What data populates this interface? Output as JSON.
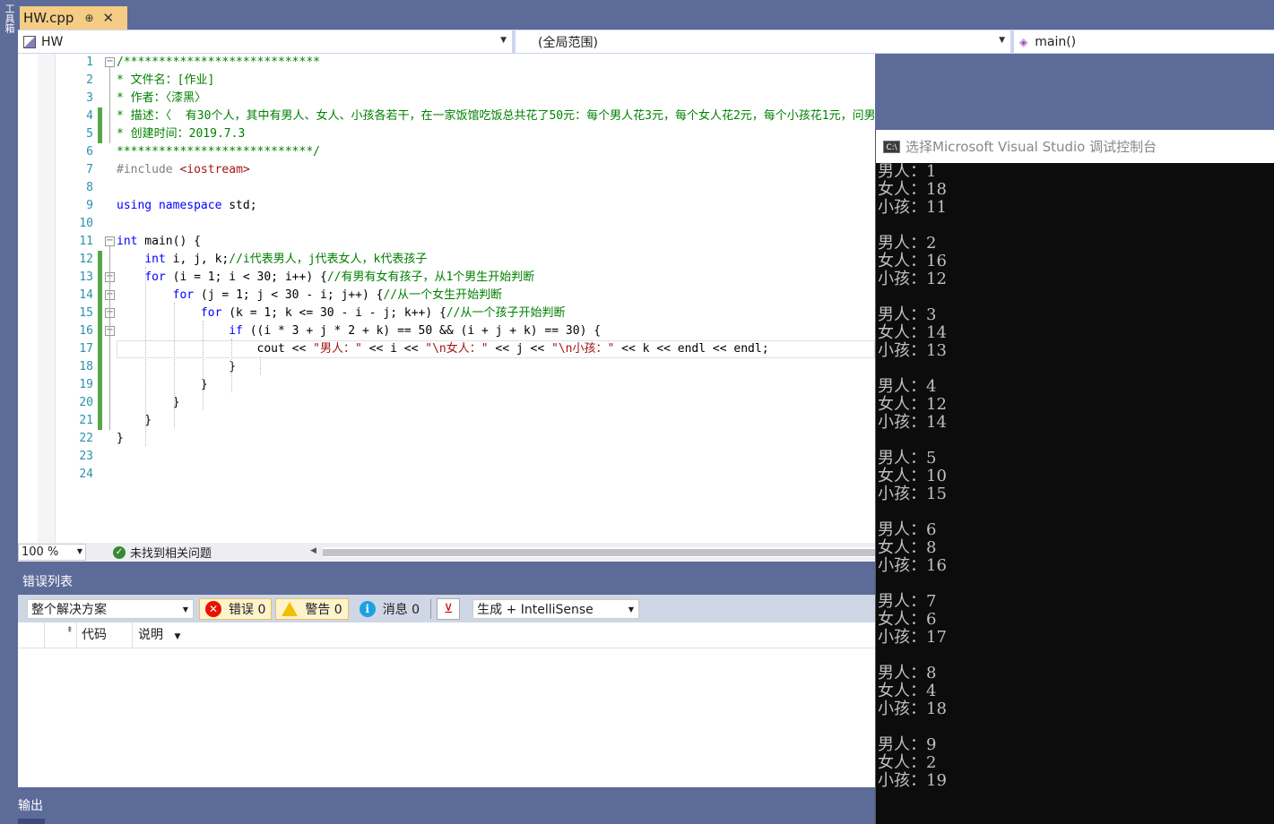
{
  "toolstrip": {
    "label": "工具箱"
  },
  "tab": {
    "title": "HW.cpp",
    "pin": "⊕",
    "close": "✕"
  },
  "nav": {
    "project": "HW",
    "scope": "(全局范围)",
    "member": "main()"
  },
  "code_lines": [
    {
      "n": "1",
      "html": "<span class='cm'>/****************************</span>"
    },
    {
      "n": "2",
      "html": "<span class='cm'>* 文件名：[作业]</span>"
    },
    {
      "n": "3",
      "html": "<span class='cm'>* 作者：〈漆黑〉</span>"
    },
    {
      "n": "4",
      "html": "<span class='cm'>* 描述：〈  有30个人，其中有男人、女人、小孩各若干，在一家饭馆吃饭总共花了50元：每个男人花3元，每个女人花2元，每个小孩花1元，问男人、女人、小孩各有几人？（用最少的循环）〉</span>"
    },
    {
      "n": "5",
      "html": "<span class='cm'>* 创建时间：2019.7.3</span>"
    },
    {
      "n": "6",
      "html": "<span class='cm'>****************************/</span>"
    },
    {
      "n": "7",
      "html": "<span class='pp'>#include </span><span class='inc'>&lt;iostream&gt;</span>"
    },
    {
      "n": "8",
      "html": ""
    },
    {
      "n": "9",
      "html": "<span class='kw'>using namespace</span> std;"
    },
    {
      "n": "10",
      "html": ""
    },
    {
      "n": "11",
      "html": "<span class='kw'>int</span> main() {"
    },
    {
      "n": "12",
      "html": "    <span class='kw'>int</span> i, j, k;<span class='cm'>//i代表男人，j代表女人，k代表孩子</span>"
    },
    {
      "n": "13",
      "html": "    <span class='kw'>for</span> (i = 1; i &lt; 30; i++) {<span class='cm'>//有男有女有孩子，从1个男生开始判断</span>"
    },
    {
      "n": "14",
      "html": "        <span class='kw'>for</span> (j = 1; j &lt; 30 - i; j++) {<span class='cm'>//从一个女生开始判断</span>"
    },
    {
      "n": "15",
      "html": "            <span class='kw'>for</span> (k = 1; k &lt;= 30 - i - j; k++) {<span class='cm'>//从一个孩子开始判断</span>"
    },
    {
      "n": "16",
      "html": "                <span class='kw'>if</span> ((i * 3 + j * 2 + k) == 50 &amp;&amp; (i + j + k) == 30) {"
    },
    {
      "n": "17",
      "html": "                    cout &lt;&lt; <span class='st'>\"男人：\"</span> &lt;&lt; i &lt;&lt; <span class='st'>\"\\n女人：\"</span> &lt;&lt; j &lt;&lt; <span class='st'>\"\\n小孩：\"</span> &lt;&lt; k &lt;&lt; endl &lt;&lt; endl;"
    },
    {
      "n": "18",
      "html": "                }"
    },
    {
      "n": "19",
      "html": "            }"
    },
    {
      "n": "20",
      "html": "        }"
    },
    {
      "n": "21",
      "html": "    }"
    },
    {
      "n": "22",
      "html": "}"
    },
    {
      "n": "23",
      "html": ""
    },
    {
      "n": "24",
      "html": ""
    }
  ],
  "status": {
    "zoom": "100 %",
    "issues": "未找到相关问题"
  },
  "error_list": {
    "title": "错误列表",
    "scope": "整个解决方案",
    "errors": "错误 0",
    "warnings": "警告 0",
    "messages": "消息 0",
    "build": "生成 + IntelliSense",
    "col_code": "代码",
    "col_desc": "说明"
  },
  "output": {
    "title": "输出"
  },
  "console": {
    "title": "选择Microsoft Visual Studio 调试控制台",
    "icon": "C:\\",
    "lines": [
      "男人：1",
      "女人：18",
      "小孩：11",
      "",
      "男人：2",
      "女人：16",
      "小孩：12",
      "",
      "男人：3",
      "女人：14",
      "小孩：13",
      "",
      "男人：4",
      "女人：12",
      "小孩：14",
      "",
      "男人：5",
      "女人：10",
      "小孩：15",
      "",
      "男人：6",
      "女人：8",
      "小孩：16",
      "",
      "男人：7",
      "女人：6",
      "小孩：17",
      "",
      "男人：8",
      "女人：4",
      "小孩：18",
      "",
      "男人：9",
      "女人：2",
      "小孩：19"
    ]
  }
}
